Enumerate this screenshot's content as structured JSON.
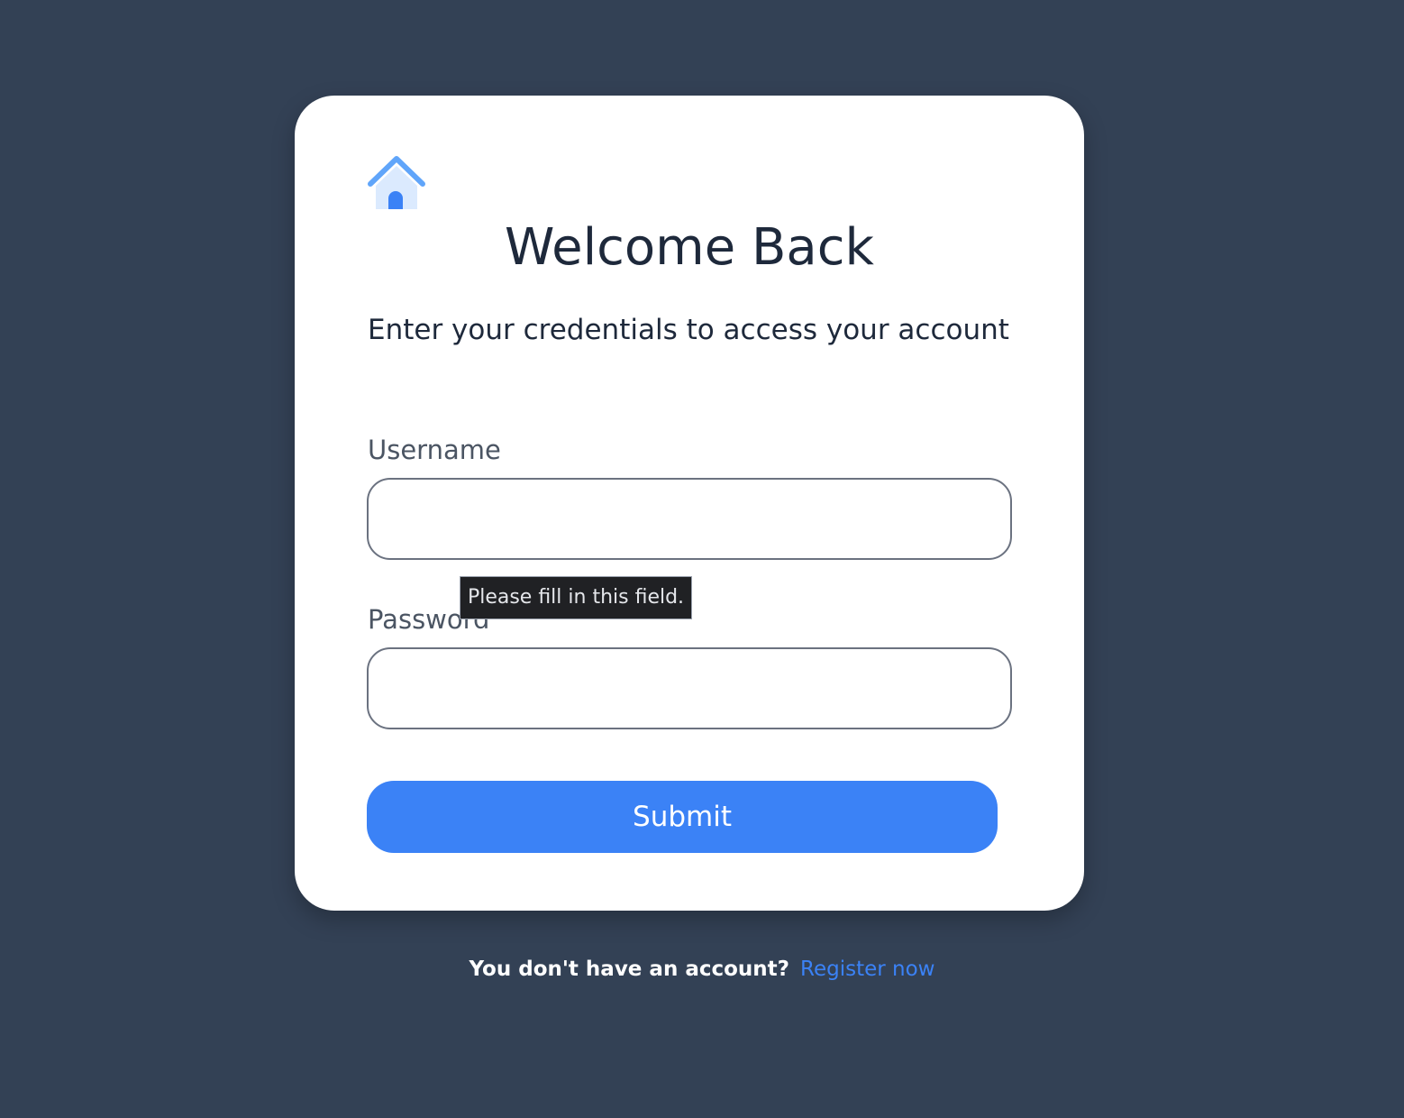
{
  "colors": {
    "page_background": "#334155",
    "card_background": "#ffffff",
    "accent": "#3b82f6",
    "heading_text": "#1e293b",
    "label_text": "#4b5563",
    "tooltip_background": "#202124"
  },
  "logo": {
    "icon": "house-icon"
  },
  "card": {
    "title": "Welcome Back",
    "subtitle": "Enter your credentials to access your account"
  },
  "form": {
    "username": {
      "label": "Username",
      "value": ""
    },
    "password": {
      "label": "Password",
      "value": ""
    },
    "validation_tooltip": "Please fill in this field.",
    "submit_label": "Submit"
  },
  "footer": {
    "question": "You don't have an account?",
    "register_link": "Register now"
  }
}
